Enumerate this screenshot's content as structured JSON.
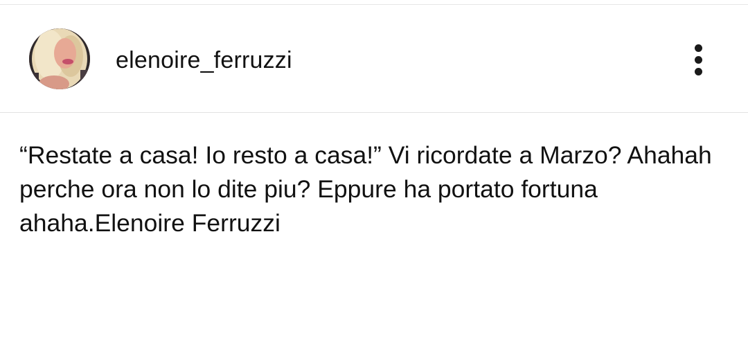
{
  "post": {
    "username": "elenoire_ferruzzi",
    "caption": "“Restate a casa! Io resto a casa!” Vi ricordate a Marzo? Ahahah perche ora non lo dite piu? Eppure ha portato fortuna ahaha.Elenoire Ferruzzi",
    "more_icon": "more-vertical-icon",
    "avatar_icon": "profile-photo"
  }
}
